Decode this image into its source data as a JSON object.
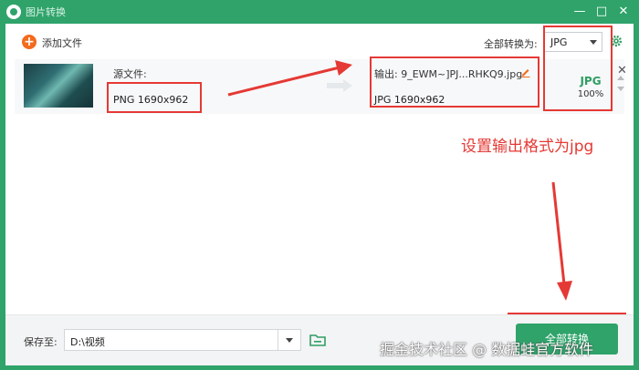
{
  "window": {
    "title": "图片转换"
  },
  "toolbar": {
    "add_file_label": "添加文件",
    "convert_all_to_label": "全部转换为:",
    "format_value": "JPG"
  },
  "file_row": {
    "source_label": "源文件:",
    "source_info": "PNG  1690x962",
    "output_label": "输出: 9_EWM~]PJ...RHKQ9.jpg",
    "output_info": "JPG  1690x962",
    "format_badge": "JPG",
    "quality": "100%"
  },
  "annotation": {
    "text": "设置输出格式为jpg",
    "color": "#e53935"
  },
  "footer": {
    "save_to_label": "保存至:",
    "save_path": "D:\\视频",
    "convert_all_button": "全部转换"
  },
  "watermark": {
    "text": "掘金技术社区 @ 数据蛙官方软件"
  },
  "colors": {
    "brand": "#2fa36a",
    "accent": "#f36a1d",
    "annotation": "#e53935"
  },
  "icons": [
    "app-logo-icon",
    "minimize-icon",
    "maximize-icon",
    "close-icon",
    "add-icon",
    "gear-icon",
    "edit-icon",
    "remove-icon",
    "folder-icon"
  ]
}
